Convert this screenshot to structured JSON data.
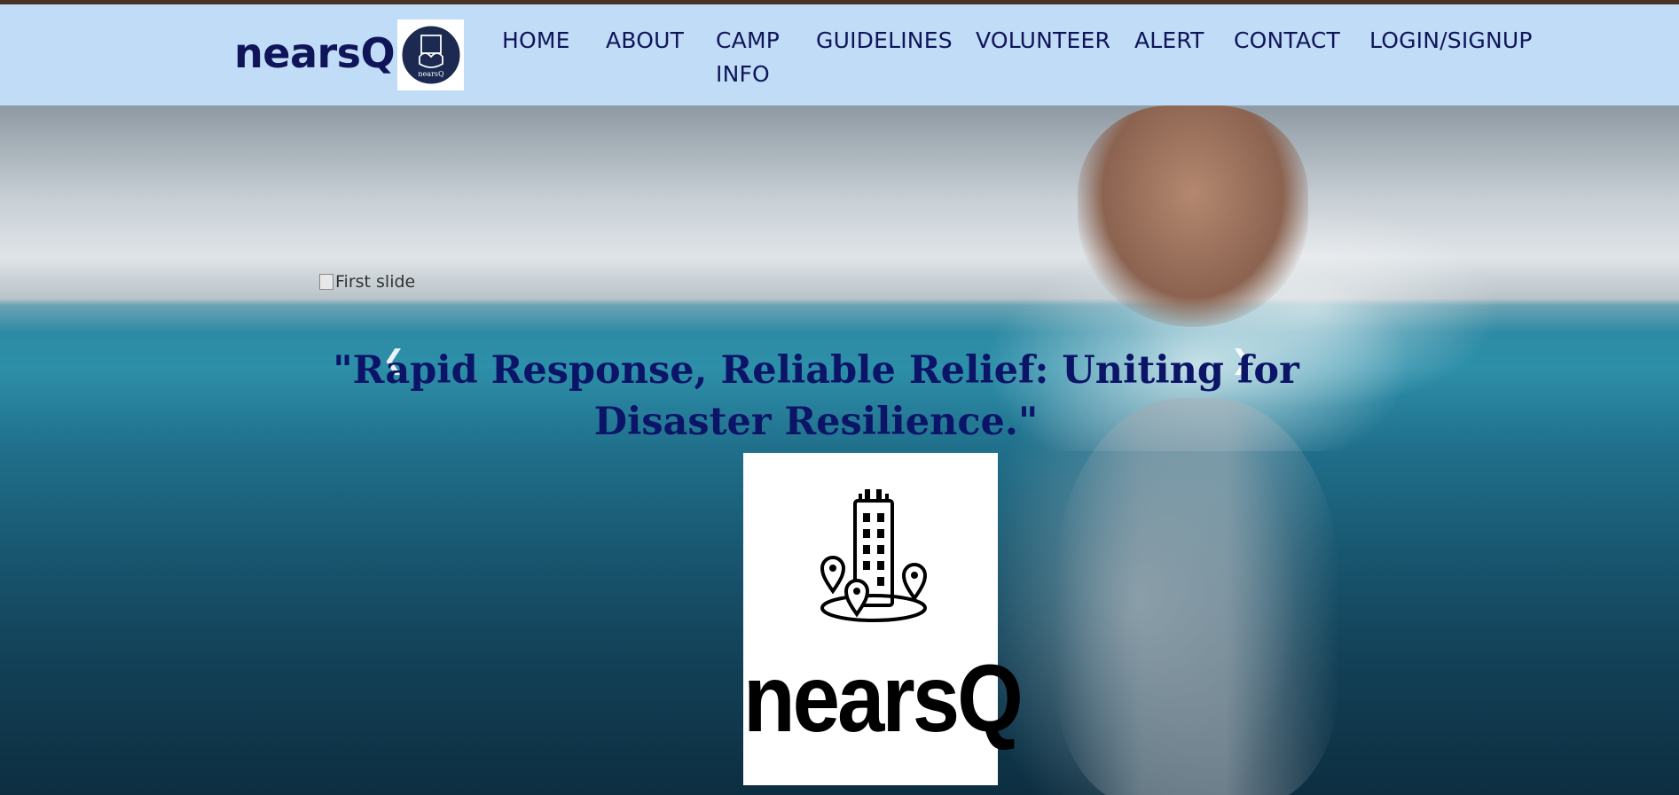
{
  "brand": {
    "name": "nearsQ",
    "logo_text": "nearsQ"
  },
  "nav": {
    "items": [
      {
        "label": "HOME"
      },
      {
        "label": "ABOUT"
      },
      {
        "label": "CAMP",
        "label2": "INFO"
      },
      {
        "label": "GUIDELINES"
      },
      {
        "label": "VOLUNTEER"
      },
      {
        "label": "ALERT"
      },
      {
        "label": "CONTACT"
      },
      {
        "label": "LOGIN/SIGNUP"
      }
    ]
  },
  "hero": {
    "image_alt": "First slide",
    "caption": "\"Rapid Response, Reliable Relief: Uniting for Disaster Resilience.\"",
    "prev_icon": "chevron-left-icon",
    "next_icon": "chevron-right-icon",
    "logo_text": "nearsQ"
  },
  "colors": {
    "navbar_bg": "#c0dcf6",
    "brand_text": "#10155a",
    "caption_text": "#0b1467",
    "top_border": "#4a3326"
  }
}
